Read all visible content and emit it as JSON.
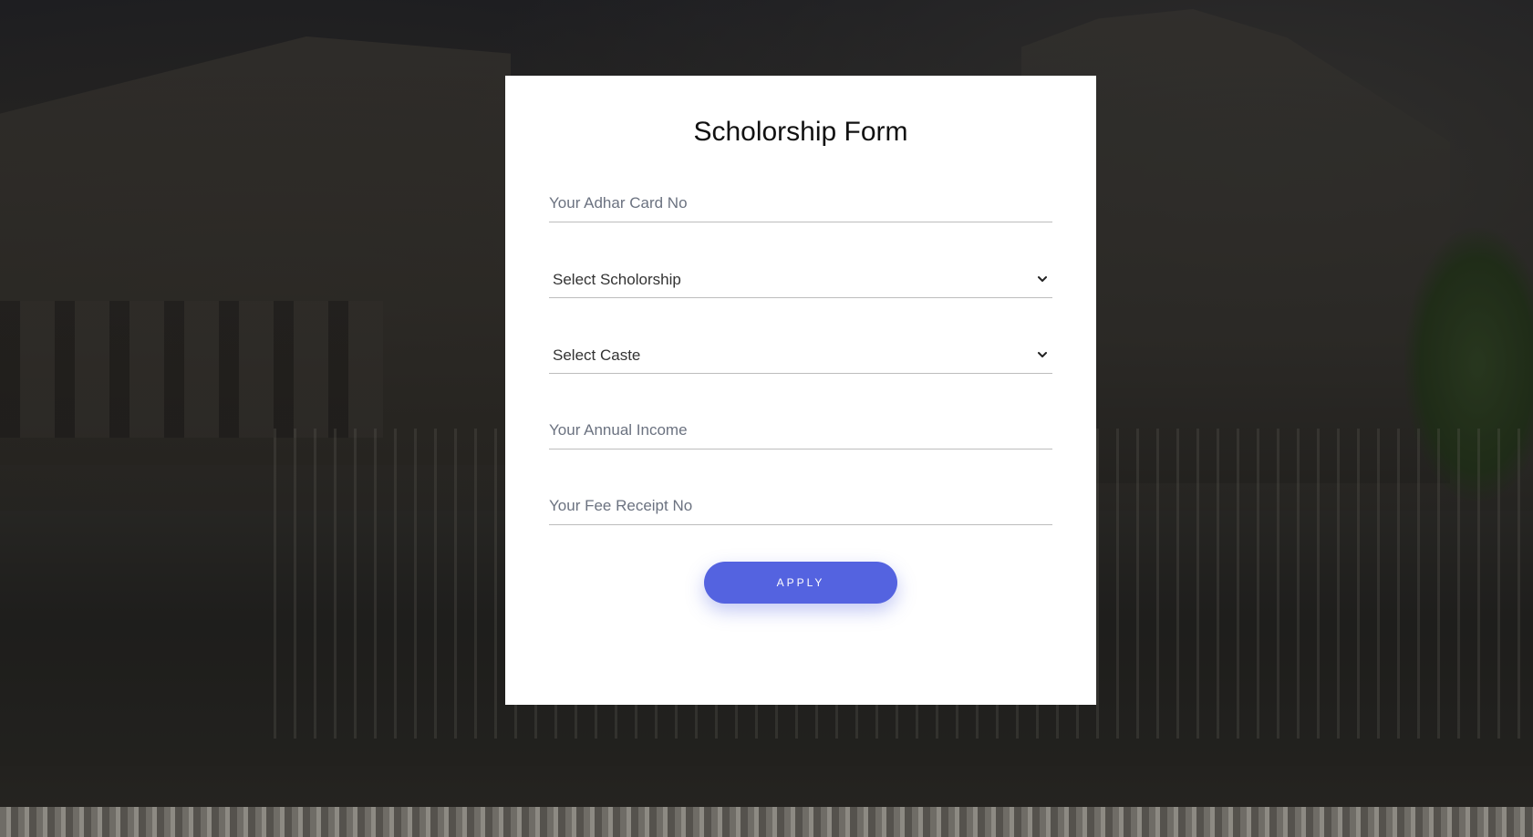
{
  "form": {
    "title": "Scholorship Form",
    "adhar_placeholder": "Your Adhar Card No",
    "scholorship_select": "Select Scholorship",
    "caste_select": "Select Caste",
    "income_placeholder": "Your Annual Income",
    "fee_placeholder": "Your Fee Receipt No",
    "apply_label": "APPLY"
  },
  "colors": {
    "button": "#5463e0",
    "card": "#ffffff"
  },
  "icons": {
    "select_arrow": "chevron-down-icon"
  }
}
